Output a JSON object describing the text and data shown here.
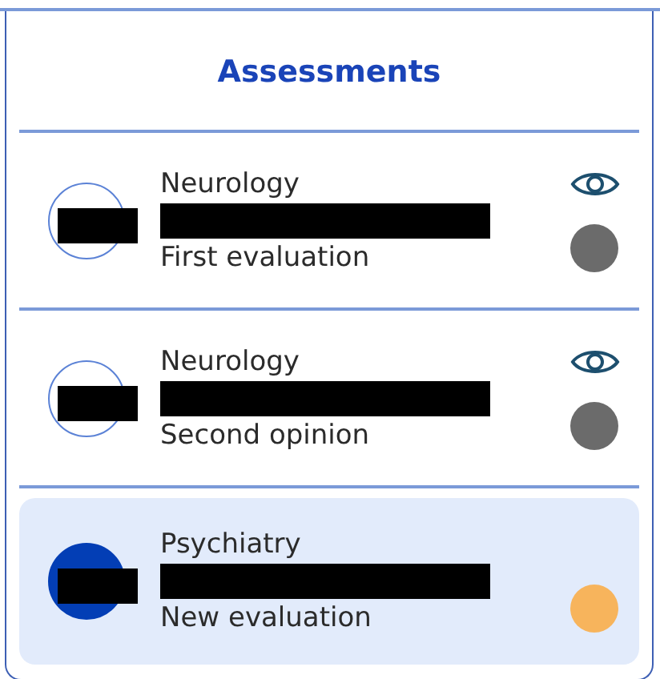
{
  "title": "Assessments",
  "assessments": [
    {
      "specialty": "Neurology",
      "description": "First evaluation",
      "selected": false,
      "viewable": true,
      "color": "#6b6b6b"
    },
    {
      "specialty": "Neurology",
      "description": "Second opinion",
      "selected": false,
      "viewable": true,
      "color": "#6b6b6b"
    },
    {
      "specialty": "Psychiatry",
      "description": "New evaluation",
      "selected": true,
      "viewable": false,
      "color": "#f7b45c"
    }
  ]
}
